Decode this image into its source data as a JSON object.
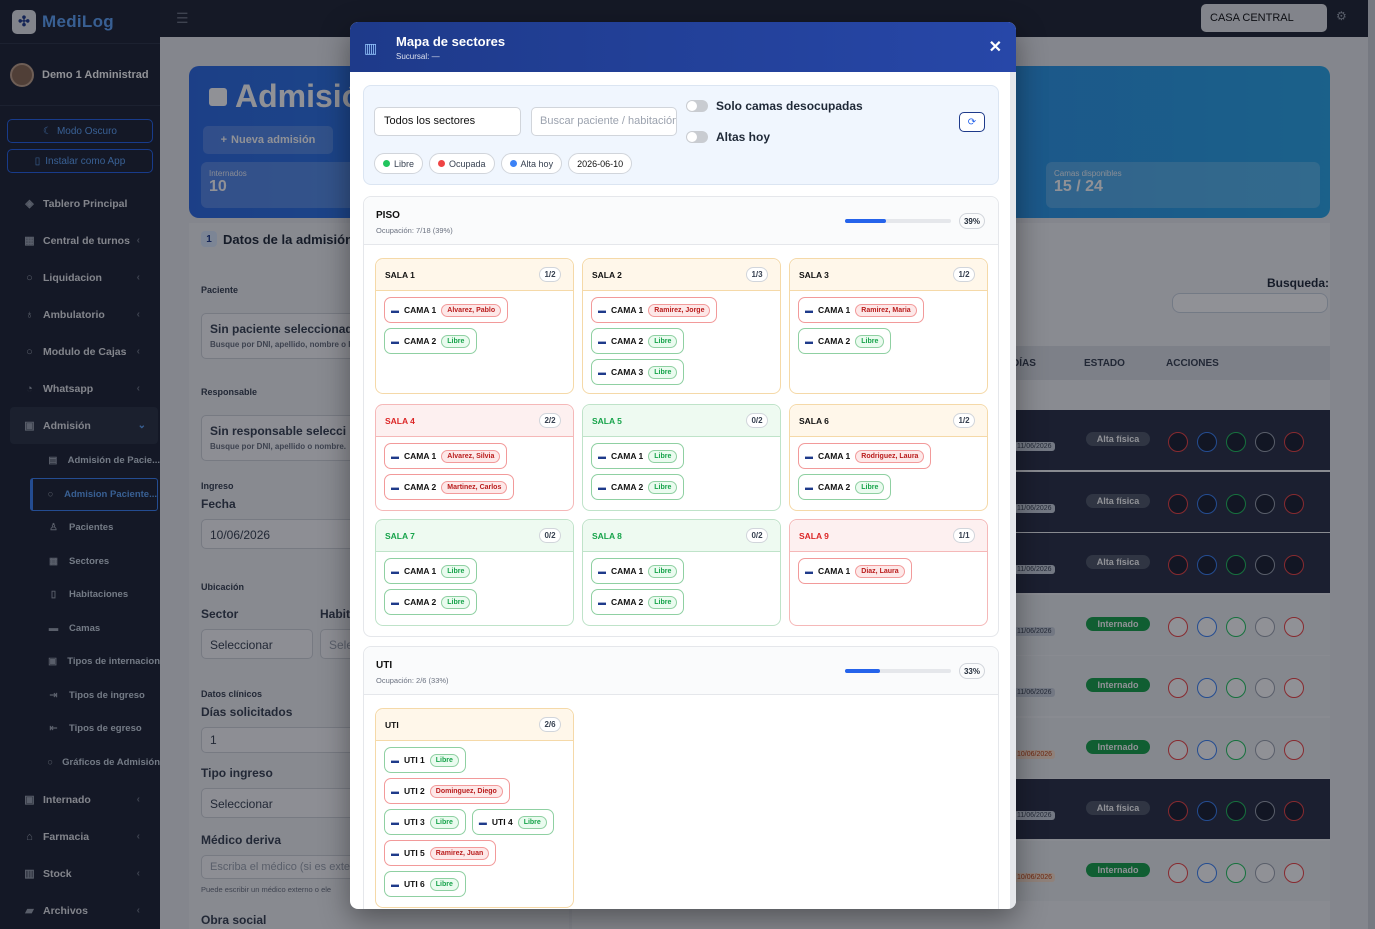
{
  "app": {
    "name": "MediLog"
  },
  "sidebar": {
    "user": "Demo 1 Administrad",
    "dark_mode": "Modo Oscuro",
    "install_app": "Instalar como App",
    "items": [
      {
        "label": "Tablero Principal"
      },
      {
        "label": "Central de turnos"
      },
      {
        "label": "Liquidacion"
      },
      {
        "label": "Ambulatorio"
      },
      {
        "label": "Modulo de Cajas"
      },
      {
        "label": "Whatsapp"
      },
      {
        "label": "Admisión"
      }
    ],
    "sub_items": [
      {
        "label": "Admisión de Pacie..."
      },
      {
        "label": "Admision Paciente..."
      },
      {
        "label": "Pacientes"
      },
      {
        "label": "Sectores"
      },
      {
        "label": "Habitaciones"
      },
      {
        "label": "Camas"
      },
      {
        "label": "Tipos de internacion"
      },
      {
        "label": "Tipos de ingreso"
      },
      {
        "label": "Tipos de egreso"
      },
      {
        "label": "Gráficos de Admisión"
      }
    ],
    "bottom_items": [
      {
        "label": "Internado"
      },
      {
        "label": "Farmacia"
      },
      {
        "label": "Stock"
      },
      {
        "label": "Archivos"
      }
    ]
  },
  "topbar": {
    "branch": "CASA CENTRAL"
  },
  "background": {
    "title": "Admisió",
    "new_admission": "Nueva admisión",
    "stat_internados_label": "Internados",
    "stat_internados_value": "10",
    "stat_camas_label": "Camas disponibles",
    "stat_camas_value": "15 / 24",
    "step_num": "1",
    "step_title": "Datos de la admisión",
    "paciente_label": "Paciente",
    "paciente_value": "Sin paciente seleccionad",
    "paciente_hint": "Busque por DNI, apellido, nombre o H",
    "responsable_label": "Responsable",
    "responsable_value": "Sin responsable selecci",
    "responsable_hint": "Busque por DNI, apellido o nombre.",
    "ingreso_label": "Ingreso",
    "fecha_label": "Fecha",
    "fecha_value": "10/06/2026",
    "ubicacion_label": "Ubicación",
    "sector_label": "Sector",
    "habit_label": "Habit",
    "sector_value": "Seleccionar",
    "habit_value": "Sele",
    "clinicos_label": "Datos clínicos",
    "dias_label": "Días solicitados",
    "dias_value": "1",
    "tipo_label": "Tipo ingreso",
    "tipo_value": "Seleccionar",
    "medico_label": "Médico deriva",
    "medico_placeholder": "Escriba el médico (si es exte",
    "medico_hint": "Puede escribir un médico externo o ele",
    "obra_label": "Obra social",
    "busqueda_label": "Busqueda:",
    "col_dias": "DÍAS",
    "col_estado": "ESTADO",
    "col_acciones": "ACCIONES",
    "rows": [
      {
        "date": "11/06/2026",
        "status": "Alta física",
        "kind": "gray",
        "dark": true
      },
      {
        "date": "11/06/2026",
        "status": "Alta física",
        "kind": "gray",
        "dark": true
      },
      {
        "date": "11/06/2026",
        "status": "Alta física",
        "kind": "gray",
        "dark": true
      },
      {
        "date": "11/06/2026",
        "status": "Internado",
        "kind": "green",
        "dark": false
      },
      {
        "date": "11/06/2026",
        "status": "Internado",
        "kind": "green",
        "dark": false
      },
      {
        "date": "10/06/2026",
        "status": "Internado",
        "kind": "green",
        "dark": false
      },
      {
        "date": "11/06/2026",
        "status": "Alta física",
        "kind": "gray",
        "dark": true
      },
      {
        "date": "10/06/2026",
        "status": "Internado",
        "kind": "green",
        "dark": false
      }
    ]
  },
  "modal": {
    "title": "Mapa de sectores",
    "subtitle": "Sucursal: —",
    "sector_select": "Todos los sectores",
    "search_placeholder": "Buscar paciente / habitación",
    "toggle_free": "Solo camas desocupadas",
    "toggle_discharge": "Altas hoy",
    "legend": [
      {
        "label": "Libre",
        "color": "#22c55e"
      },
      {
        "label": "Ocupada",
        "color": "#ef4444"
      },
      {
        "label": "Alta hoy",
        "color": "#3b82f6"
      }
    ],
    "date": "2026-06-10",
    "sectors": [
      {
        "name": "PISO",
        "occupancy": "Ocupación: 7/18 (39%)",
        "pct_label": "39%",
        "pct": 39,
        "rooms": [
          {
            "name": "SALA 1",
            "count": "1/2",
            "tone": "amber",
            "beds": [
              {
                "name": "CAMA 1",
                "tag": "Alvarez, Pablo",
                "free": false
              },
              {
                "name": "CAMA 2",
                "tag": "Libre",
                "free": true
              }
            ]
          },
          {
            "name": "SALA 2",
            "count": "1/3",
            "tone": "amber",
            "beds": [
              {
                "name": "CAMA 1",
                "tag": "Ramirez, Jorge",
                "free": false
              },
              {
                "name": "CAMA 2",
                "tag": "Libre",
                "free": true
              },
              {
                "name": "CAMA 3",
                "tag": "Libre",
                "free": true
              }
            ]
          },
          {
            "name": "SALA 3",
            "count": "1/2",
            "tone": "amber",
            "beds": [
              {
                "name": "CAMA 1",
                "tag": "Ramirez, Maria",
                "free": false
              },
              {
                "name": "CAMA 2",
                "tag": "Libre",
                "free": true
              }
            ]
          },
          {
            "name": "SALA 4",
            "count": "2/2",
            "tone": "red",
            "beds": [
              {
                "name": "CAMA 1",
                "tag": "Alvarez, Silvia",
                "free": false
              },
              {
                "name": "CAMA 2",
                "tag": "Martinez, Carlos",
                "free": false
              }
            ]
          },
          {
            "name": "SALA 5",
            "count": "0/2",
            "tone": "green",
            "beds": [
              {
                "name": "CAMA 1",
                "tag": "Libre",
                "free": true
              },
              {
                "name": "CAMA 2",
                "tag": "Libre",
                "free": true
              }
            ]
          },
          {
            "name": "SALA 6",
            "count": "1/2",
            "tone": "amber",
            "beds": [
              {
                "name": "CAMA 1",
                "tag": "Rodriguez, Laura",
                "free": false
              },
              {
                "name": "CAMA 2",
                "tag": "Libre",
                "free": true
              }
            ]
          },
          {
            "name": "SALA 7",
            "count": "0/2",
            "tone": "green",
            "beds": [
              {
                "name": "CAMA 1",
                "tag": "Libre",
                "free": true
              },
              {
                "name": "CAMA 2",
                "tag": "Libre",
                "free": true
              }
            ]
          },
          {
            "name": "SALA 8",
            "count": "0/2",
            "tone": "green",
            "beds": [
              {
                "name": "CAMA 1",
                "tag": "Libre",
                "free": true
              },
              {
                "name": "CAMA 2",
                "tag": "Libre",
                "free": true
              }
            ]
          },
          {
            "name": "SALA 9",
            "count": "1/1",
            "tone": "red",
            "beds": [
              {
                "name": "CAMA 1",
                "tag": "Diaz, Laura",
                "free": false
              }
            ]
          }
        ]
      },
      {
        "name": "UTI",
        "occupancy": "Ocupación: 2/6 (33%)",
        "pct_label": "33%",
        "pct": 33,
        "rooms": [
          {
            "name": "UTI",
            "count": "2/6",
            "tone": "amber",
            "beds": [
              {
                "name": "UTI 1",
                "tag": "Libre",
                "free": true
              },
              {
                "name": "UTI 2",
                "tag": "Dominguez, Diego",
                "free": false
              },
              {
                "name": "UTI 3",
                "tag": "Libre",
                "free": true
              },
              {
                "name": "UTI 4",
                "tag": "Libre",
                "free": true
              },
              {
                "name": "UTI 5",
                "tag": "Ramirez, Juan",
                "free": false
              },
              {
                "name": "UTI 6",
                "tag": "Libre",
                "free": true
              }
            ]
          }
        ]
      }
    ]
  }
}
